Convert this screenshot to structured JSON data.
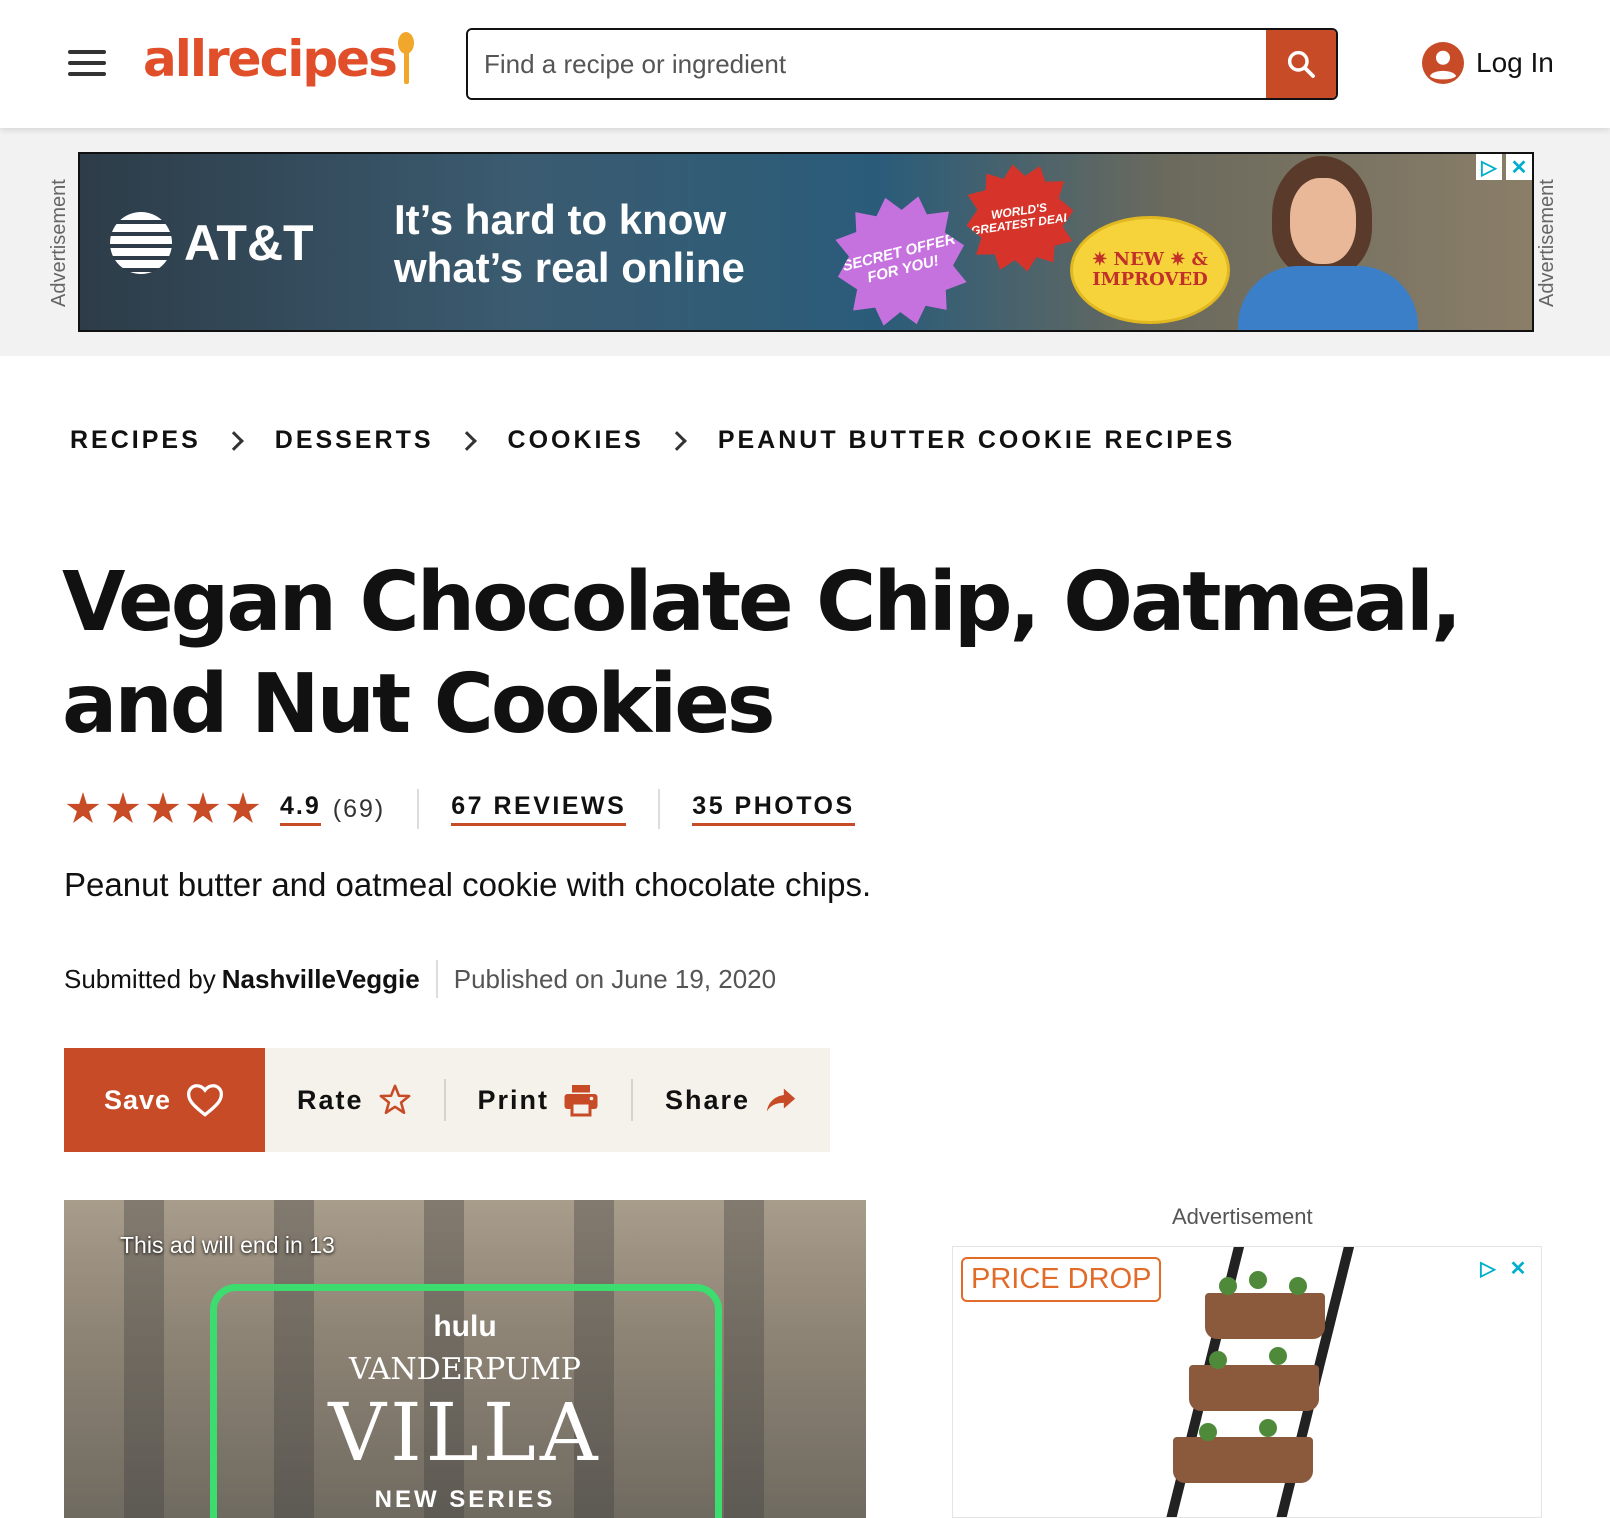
{
  "header": {
    "logo_text": "allrecipes",
    "search_placeholder": "Find a recipe or ingredient",
    "login_label": "Log In"
  },
  "top_ad": {
    "side_label": "Advertisement",
    "brand": "AT&T",
    "headline": "It’s hard to know what’s real online",
    "burst_purple": "SECRET OFFER FOR YOU!",
    "burst_red": "WORLD'S GREATEST DEAL",
    "badge_yellow": "✷ NEW ✷ & IMPROVED"
  },
  "breadcrumb": [
    "RECIPES",
    "DESSERTS",
    "COOKIES",
    "PEANUT BUTTER COOKIE RECIPES"
  ],
  "recipe": {
    "title": "Vegan Chocolate Chip, Oatmeal, and Nut Cookies",
    "rating": "4.9",
    "rating_count": "(69)",
    "stars": 4.9,
    "reviews_link": "67 REVIEWS",
    "photos_link": "35 PHOTOS",
    "description": "Peanut butter and oatmeal cookie with chocolate chips.",
    "submitted_by_label": "Submitted by",
    "author": "NashvilleVeggie",
    "published": "Published on June 19, 2020"
  },
  "actions": {
    "save": "Save",
    "rate": "Rate",
    "print": "Print",
    "share": "Share"
  },
  "video_ad": {
    "countdown": "This ad will end in 13",
    "network": "hulu",
    "show_line1": "VANDERPUMP",
    "show_line2": "VILLA",
    "tagline": "NEW SERIES"
  },
  "right_ad": {
    "label": "Advertisement",
    "badge": "PRICE DROP"
  },
  "colors": {
    "brand_orange": "#c84b27",
    "logo_orange": "#e04f2a",
    "action_bar_bg": "#f4f2ea"
  }
}
